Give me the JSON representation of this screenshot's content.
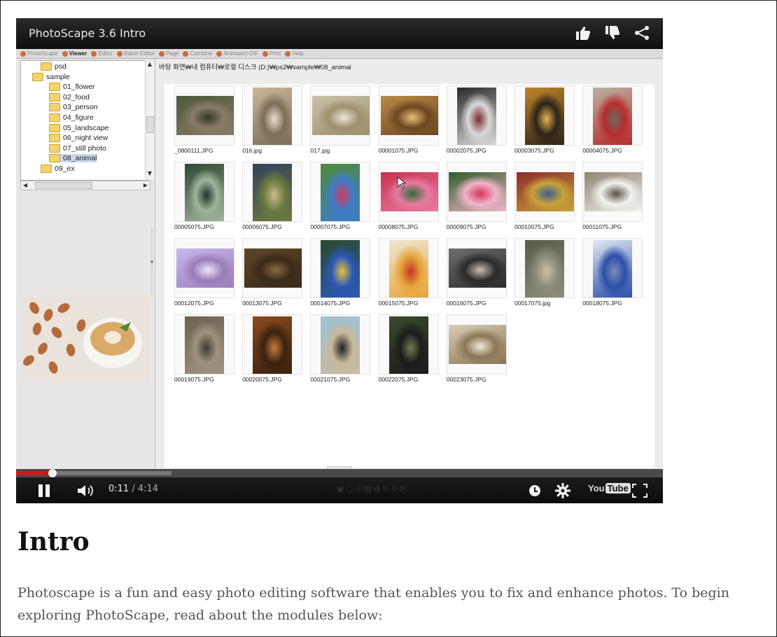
{
  "video": {
    "title": "PhotoScape 3.6 Intro",
    "time_current": "0:11",
    "time_total": "/ 4:14",
    "progress_fraction": 0.043,
    "buffered_fraction": 0.24,
    "youtube_you": "You",
    "youtube_tube": "Tube"
  },
  "app": {
    "menu_items": [
      "PhotoScape",
      "Viewer",
      "Editor",
      "Batch Editor",
      "Page",
      "Combine",
      "Animated GIF",
      "Print",
      "Help"
    ],
    "active_menu": "Viewer",
    "path": "바탕 화면₩내 컴퓨터₩로컬 디스크 (D:)₩ps2₩sample₩08_animal",
    "tree": [
      {
        "label": "psd",
        "indent": 3
      },
      {
        "label": "sample",
        "indent": 2
      },
      {
        "label": "01_flower",
        "indent": 4
      },
      {
        "label": "02_food",
        "indent": 4
      },
      {
        "label": "03_person",
        "indent": 4
      },
      {
        "label": "04_figure",
        "indent": 4
      },
      {
        "label": "05_landscape",
        "indent": 4
      },
      {
        "label": "06_night view",
        "indent": 4
      },
      {
        "label": "07_still photo",
        "indent": 4
      },
      {
        "label": "08_animal",
        "indent": 4,
        "selected": true
      },
      {
        "label": "09_ex",
        "indent": 3
      }
    ],
    "thumbnails": [
      {
        "label": "_0800111.JPG",
        "colors": [
          "#4b5a3a",
          "#8a7b67",
          "#2f3b2a"
        ],
        "portrait": false
      },
      {
        "label": "016.jpg",
        "colors": [
          "#c9b79a",
          "#7d6d58",
          "#e8dfd0"
        ],
        "portrait": true
      },
      {
        "label": "017.jpg",
        "colors": [
          "#c9c2aa",
          "#9e8f6e",
          "#ede6d6"
        ],
        "portrait": false
      },
      {
        "label": "00001075.JPG",
        "colors": [
          "#b98b46",
          "#6d4621",
          "#e6c17a"
        ],
        "portrait": false
      },
      {
        "label": "00002075.JPG",
        "colors": [
          "#2b2b2b",
          "#d9d9d9",
          "#7a2b2b"
        ],
        "portrait": true
      },
      {
        "label": "00003075.JPG",
        "colors": [
          "#c0842d",
          "#2c2418",
          "#e3b450"
        ],
        "portrait": true
      },
      {
        "label": "00004075.JPG",
        "colors": [
          "#b9b2a2",
          "#b62d2d",
          "#6e6a60"
        ],
        "portrait": true
      },
      {
        "label": "00005075.JPG",
        "colors": [
          "#2f4634",
          "#9fb59a",
          "#21312a"
        ],
        "portrait": true
      },
      {
        "label": "00006075.JPG",
        "colors": [
          "#33415c",
          "#6b7b40",
          "#cdbb8f"
        ],
        "portrait": true
      },
      {
        "label": "00007075.JPG",
        "colors": [
          "#4f8a3a",
          "#3d7dc8",
          "#d63a5a"
        ],
        "portrait": true
      },
      {
        "label": "00008075.JPG",
        "colors": [
          "#c8324f",
          "#e77aa0",
          "#2f6b3a"
        ],
        "portrait": false
      },
      {
        "label": "00009075.JPG",
        "colors": [
          "#2f5e2a",
          "#f0b5c8",
          "#d8345a"
        ],
        "portrait": false
      },
      {
        "label": "00010075.JPG",
        "colors": [
          "#8a2b2b",
          "#c9a23a",
          "#3a5e8a"
        ],
        "portrait": false
      },
      {
        "label": "00011075.JPG",
        "colors": [
          "#8e8470",
          "#f2f2ee",
          "#5a5140"
        ],
        "portrait": false
      },
      {
        "label": "00012075.JPG",
        "colors": [
          "#c7b8ea",
          "#9a7db8",
          "#efe6fb"
        ],
        "portrait": false
      },
      {
        "label": "00013075.JPG",
        "colors": [
          "#5e4528",
          "#3a2a18",
          "#8b6a44"
        ],
        "portrait": false
      },
      {
        "label": "00014075.JPG",
        "colors": [
          "#2b4a2b",
          "#2b58b8",
          "#e6c23a"
        ],
        "portrait": true
      },
      {
        "label": "00015075.JPG",
        "colors": [
          "#f0e6d4",
          "#e6a53a",
          "#c8362b"
        ],
        "portrait": true
      },
      {
        "label": "00016075.JPG",
        "colors": [
          "#6e6e6e",
          "#2a2a2a",
          "#c9c0b0"
        ],
        "portrait": false
      },
      {
        "label": "00017075.jpg",
        "colors": [
          "#5a5a4a",
          "#8d8d7a",
          "#c9c2a9"
        ],
        "portrait": true
      },
      {
        "label": "00018075.JPG",
        "colors": [
          "#dfe7f3",
          "#2b4fa8",
          "#7a8eb8"
        ],
        "portrait": true
      },
      {
        "label": "00019075.JPG",
        "colors": [
          "#6b6252",
          "#9c9480",
          "#3f3a30"
        ],
        "portrait": true
      },
      {
        "label": "00020075.JPG",
        "colors": [
          "#8a4a1e",
          "#3a2210",
          "#c97b3a"
        ],
        "portrait": true
      },
      {
        "label": "00021075.JPG",
        "colors": [
          "#9dc3d8",
          "#c9b99a",
          "#1e1e1e"
        ],
        "portrait": true
      },
      {
        "label": "00022075.JPG",
        "colors": [
          "#3a4a2a",
          "#1b1b1b",
          "#6e7b50"
        ],
        "portrait": true
      },
      {
        "label": "00023075.JPG",
        "colors": [
          "#d8cdb6",
          "#8a7656",
          "#f2ead8"
        ],
        "portrait": false
      }
    ]
  },
  "article": {
    "heading": "Intro",
    "paragraph": "Photoscape is a fun and easy photo editing software that enables you to fix and enhance photos. To begin exploring PhotoScape, read about the modules below:"
  },
  "colors": {
    "progress_played": "#cc181e",
    "page_text": "#555555",
    "heading": "#111111"
  }
}
